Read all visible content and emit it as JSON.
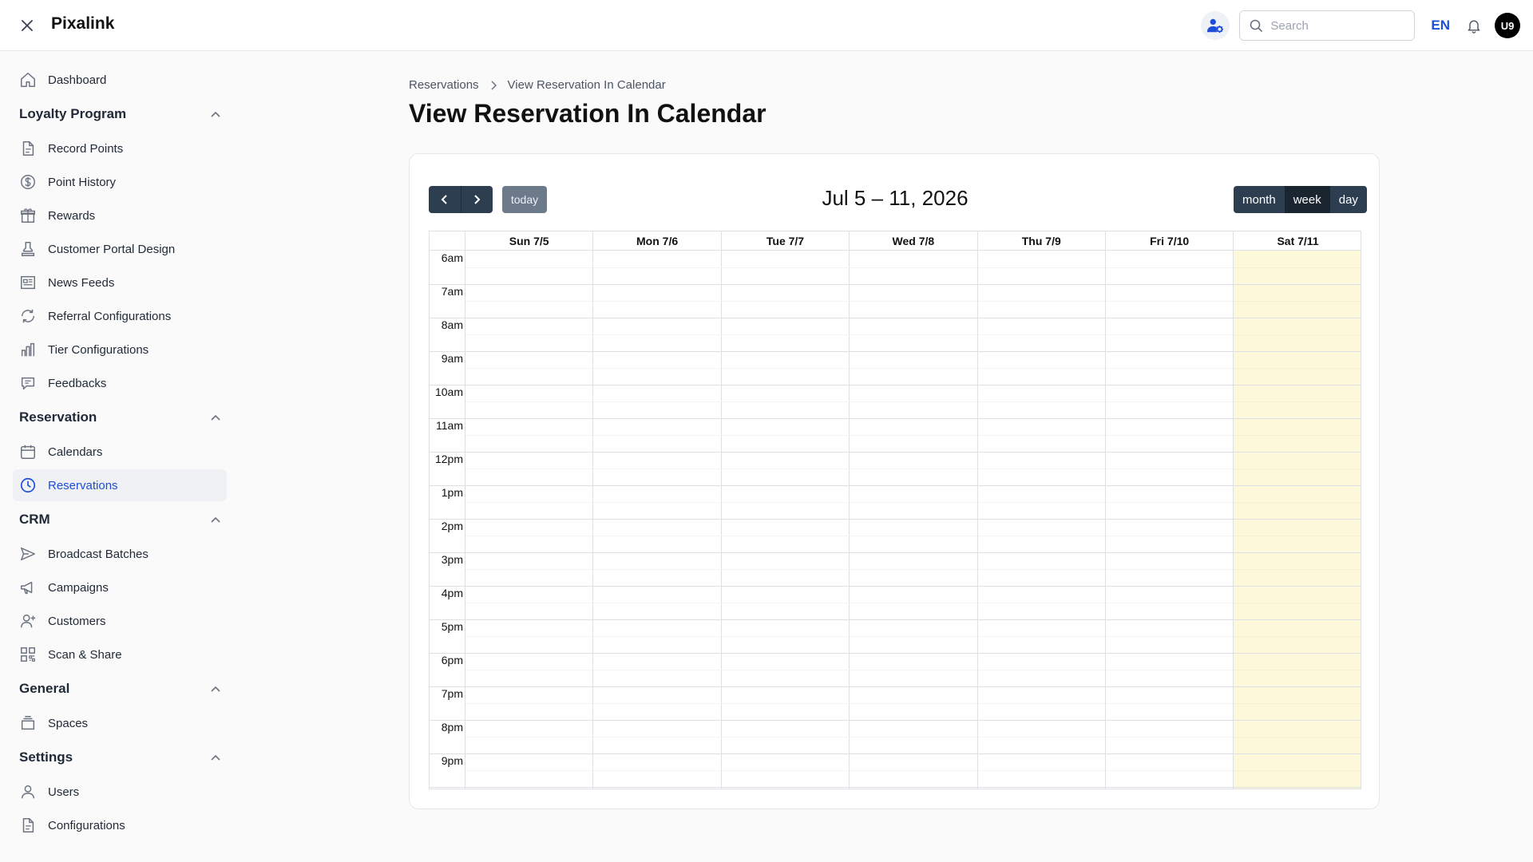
{
  "app": {
    "title": "Pixalink"
  },
  "header": {
    "search_placeholder": "Search",
    "language": "EN",
    "avatar_initials": "U9"
  },
  "sidebar": {
    "top_items": [
      {
        "label": "Dashboard",
        "icon": "home-icon"
      }
    ],
    "sections": [
      {
        "title": "Loyalty Program",
        "items": [
          {
            "label": "Record Points",
            "icon": "document-icon"
          },
          {
            "label": "Point History",
            "icon": "dollar-circle-icon"
          },
          {
            "label": "Rewards",
            "icon": "gift-icon"
          },
          {
            "label": "Customer Portal Design",
            "icon": "stamp-icon"
          },
          {
            "label": "News Feeds",
            "icon": "newspaper-icon"
          },
          {
            "label": "Referral Configurations",
            "icon": "refresh-icon"
          },
          {
            "label": "Tier Configurations",
            "icon": "bar-chart-icon"
          },
          {
            "label": "Feedbacks",
            "icon": "chat-icon"
          }
        ]
      },
      {
        "title": "Reservation",
        "items": [
          {
            "label": "Calendars",
            "icon": "calendar-icon"
          },
          {
            "label": "Reservations",
            "icon": "clock-icon",
            "active": true
          }
        ]
      },
      {
        "title": "CRM",
        "items": [
          {
            "label": "Broadcast Batches",
            "icon": "send-icon"
          },
          {
            "label": "Campaigns",
            "icon": "megaphone-icon"
          },
          {
            "label": "Customers",
            "icon": "user-plus-icon"
          },
          {
            "label": "Scan & Share",
            "icon": "qr-code-icon"
          }
        ]
      },
      {
        "title": "General",
        "items": [
          {
            "label": "Spaces",
            "icon": "layers-icon"
          }
        ]
      },
      {
        "title": "Settings",
        "items": [
          {
            "label": "Users",
            "icon": "user-icon"
          },
          {
            "label": "Configurations",
            "icon": "document-icon"
          }
        ]
      }
    ]
  },
  "breadcrumb": [
    "Reservations",
    "View Reservation In Calendar"
  ],
  "page_title": "View Reservation In Calendar",
  "calendar": {
    "today_label": "today",
    "title": "Jul 5 – 11, 2026",
    "views": [
      {
        "label": "month",
        "active": false
      },
      {
        "label": "week",
        "active": true
      },
      {
        "label": "day",
        "active": false
      }
    ],
    "days": [
      "Sun 7/5",
      "Mon 7/6",
      "Tue 7/7",
      "Wed 7/8",
      "Thu 7/9",
      "Fri 7/10",
      "Sat 7/11"
    ],
    "today_index": 6,
    "hours": [
      "6am",
      "7am",
      "8am",
      "9am",
      "10am",
      "11am",
      "12pm",
      "1pm",
      "2pm",
      "3pm",
      "4pm",
      "5pm",
      "6pm",
      "7pm",
      "8pm",
      "9pm"
    ],
    "colors": {
      "today_bg": "#fef8db",
      "button_bg": "#2c3e50",
      "active_view_bg": "#1a252f",
      "accent": "#1d4ed8"
    }
  }
}
